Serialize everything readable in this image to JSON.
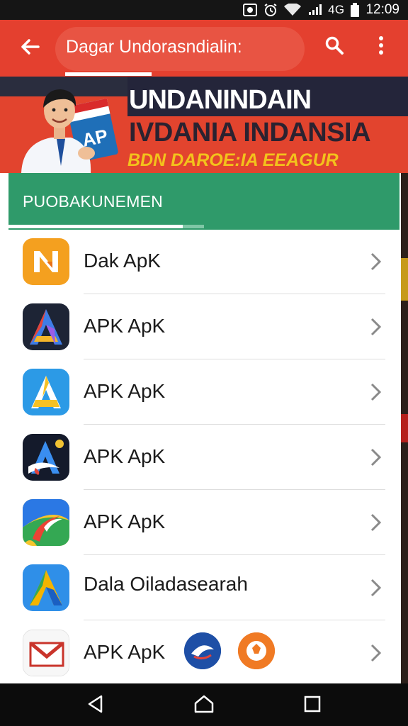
{
  "status_bar": {
    "network": "4G",
    "time": "12:09"
  },
  "app_bar": {
    "title": "Dagar Undorasndialin:",
    "back_icon": "arrow-left-icon",
    "search_icon": "search-icon",
    "more_icon": "more-vertical-icon"
  },
  "banner": {
    "line1": "UNDANINDAIN",
    "line2": "IVDANIA INDANSIA",
    "line3": "BDN DAROE:IA EEAGUR",
    "card_text": "AP"
  },
  "section": {
    "title": "PUOBAKUNEMEN",
    "progress_fraction": 0.45
  },
  "apps": [
    {
      "label": "Dak ApK",
      "icon": "orange-n-app-icon"
    },
    {
      "label": "APK ApK",
      "icon": "dark-a-colorful-app-icon"
    },
    {
      "label": "APK ApK",
      "icon": "blue-yellow-a-app-icon"
    },
    {
      "label": "APK ApK",
      "icon": "dark-a-blue-app-icon"
    },
    {
      "label": "APK ApK",
      "icon": "swirl-colorful-app-icon"
    },
    {
      "label": "Dala Oiladasearah",
      "icon": "blue-green-a-app-icon"
    },
    {
      "label": "APK ApK",
      "icon": "mail-envelope-app-icon"
    }
  ],
  "extra_icons": [
    "blue-chat-bubble-icon",
    "orange-ball-icon"
  ],
  "nav_bar": {
    "back": "nav-back-icon",
    "home": "nav-home-icon",
    "recents": "nav-recents-icon"
  },
  "colors": {
    "app_bar": "#e4402f",
    "section_header": "#2f9a6a",
    "banner_red": "#e2442e",
    "banner_yellow": "#f3c21c"
  }
}
